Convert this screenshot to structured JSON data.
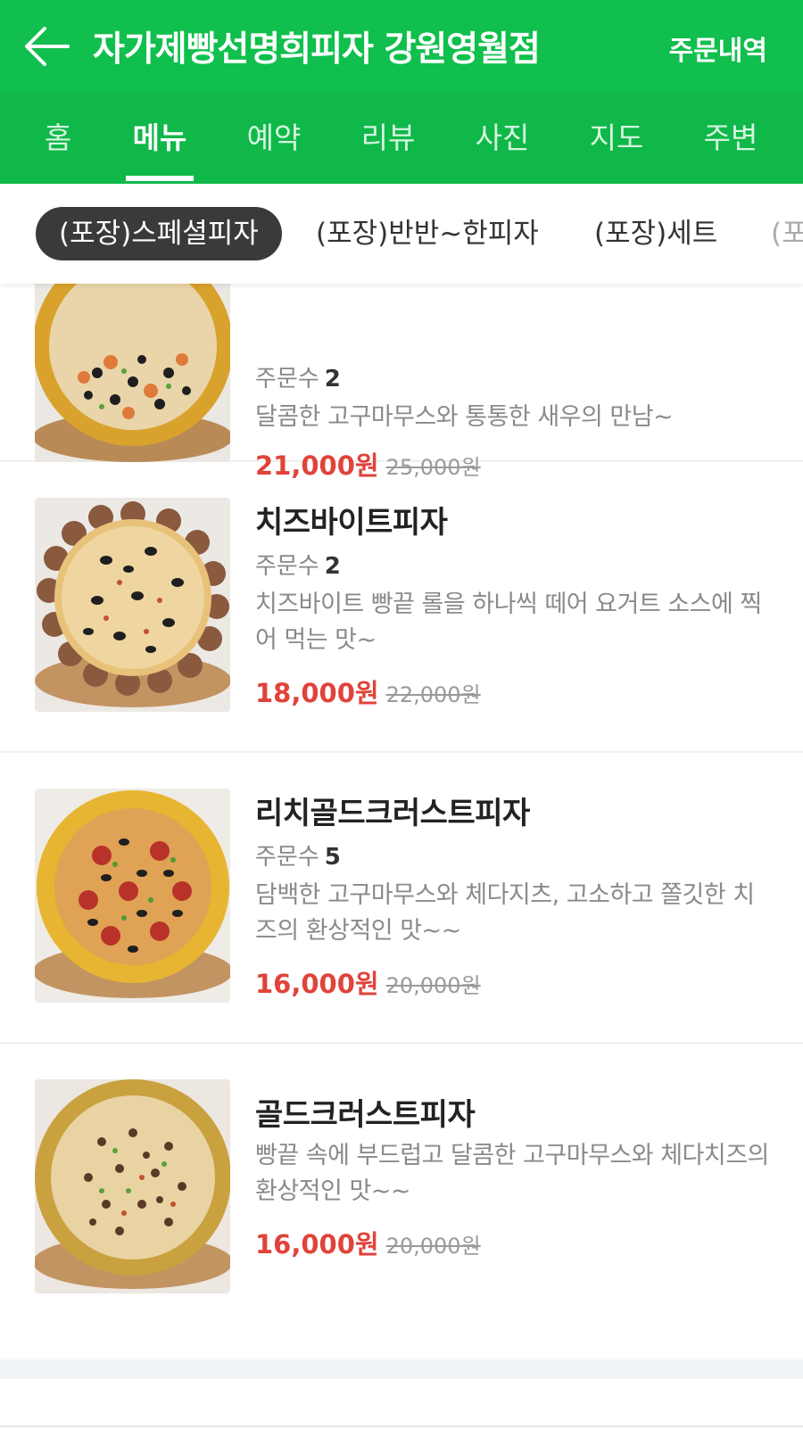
{
  "header": {
    "store_name": "자가제빵선명희피자 강원영월점",
    "order_history": "주문내역"
  },
  "tabs": [
    {
      "label": "홈"
    },
    {
      "label": "메뉴"
    },
    {
      "label": "예약"
    },
    {
      "label": "리뷰"
    },
    {
      "label": "사진"
    },
    {
      "label": "지도"
    },
    {
      "label": "주변"
    }
  ],
  "active_tab": "메뉴",
  "categories": [
    {
      "label": "(포장)스페셜피자"
    },
    {
      "label": "(포장)반반~한피자"
    },
    {
      "label": "(포장)세트"
    },
    {
      "label": "(포"
    }
  ],
  "menu_items": [
    {
      "name": "",
      "order_count_label": "주문수",
      "order_count": "2",
      "description": "달콤한 고구마무스와 통통한 새우의 만남~",
      "price": "21,000원",
      "original_price": "25,000원"
    },
    {
      "name": "치즈바이트피자",
      "order_count_label": "주문수",
      "order_count": "2",
      "description": "치즈바이트 빵끝 롤을 하나씩 떼어 요거트 소스에 찍어 먹는 맛~",
      "price": "18,000원",
      "original_price": "22,000원"
    },
    {
      "name": "리치골드크러스트피자",
      "order_count_label": "주문수",
      "order_count": "5",
      "description": "담백한 고구마무스와 체다지츠, 고소하고 쫄깃한 치즈의 환상적인 맛~~",
      "price": "16,000원",
      "original_price": "20,000원"
    },
    {
      "name": "골드크러스트피자",
      "description": "빵끝 속에 부드럽고 달콤한 고구마무스와 체다치즈의 환상적인 맛~~",
      "price": "16,000원",
      "original_price": "20,000원"
    }
  ],
  "colors": {
    "header_green": "#10bf4d",
    "tab_green": "#0fb849",
    "price_red": "#e0433a",
    "chip_active": "#3a3a3a"
  }
}
